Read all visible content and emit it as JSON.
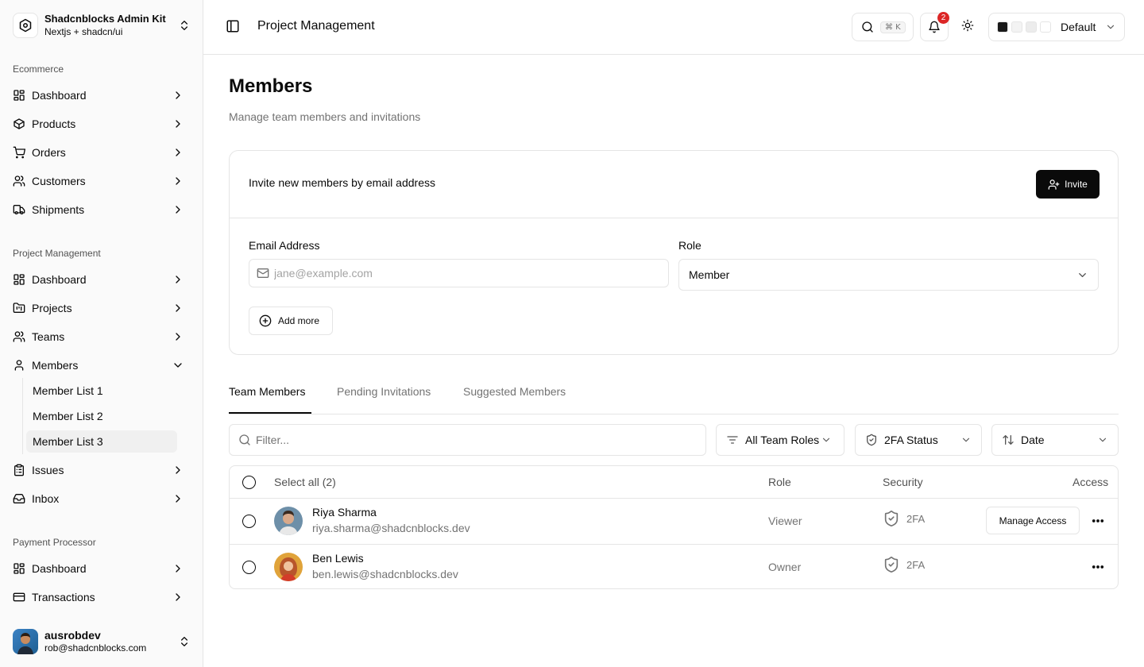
{
  "brand": {
    "title": "Shadcnblocks Admin Kit",
    "subtitle": "Nextjs + shadcn/ui"
  },
  "sidebar": {
    "groups": [
      {
        "label": "Ecommerce",
        "items": [
          "Dashboard",
          "Products",
          "Orders",
          "Customers",
          "Shipments"
        ]
      },
      {
        "label": "Project Management",
        "items": [
          "Dashboard",
          "Projects",
          "Teams",
          "Members",
          "Issues",
          "Inbox"
        ]
      },
      {
        "label": "Payment Processor",
        "items": [
          "Dashboard",
          "Transactions"
        ]
      }
    ],
    "members_sub": [
      "Member List 1",
      "Member List 2",
      "Member List 3"
    ]
  },
  "user": {
    "name": "ausrobdev",
    "email": "rob@shadcnblocks.com"
  },
  "header": {
    "title": "Project Management",
    "search_kbd": "⌘ K",
    "notification_count": "2",
    "theme_label": "Default"
  },
  "page": {
    "title": "Members",
    "subtitle": "Manage team members and invitations"
  },
  "invite": {
    "heading": "Invite new members by email address",
    "invite_label": "Invite",
    "email_label": "Email Address",
    "email_placeholder": "jane@example.com",
    "role_label": "Role",
    "role_value": "Member",
    "add_more_label": "Add more"
  },
  "tabs": [
    "Team Members",
    "Pending Invitations",
    "Suggested Members"
  ],
  "filters": {
    "placeholder": "Filter...",
    "roles": "All Team Roles",
    "twofa": "2FA Status",
    "date": "Date"
  },
  "table": {
    "headers": {
      "select_all": "Select all (2)",
      "role": "Role",
      "security": "Security",
      "access": "Access"
    },
    "rows": [
      {
        "name": "Riya Sharma",
        "email": "riya.sharma@shadcnblocks.dev",
        "role": "Viewer",
        "security": "2FA",
        "action": "Manage Access"
      },
      {
        "name": "Ben Lewis",
        "email": "ben.lewis@shadcnblocks.dev",
        "role": "Owner",
        "security": "2FA",
        "action": ""
      }
    ]
  },
  "colors": {
    "accent": "#0a0a0a",
    "badge": "#dc2626",
    "border": "#e5e5e5",
    "muted_text": "#737373"
  }
}
